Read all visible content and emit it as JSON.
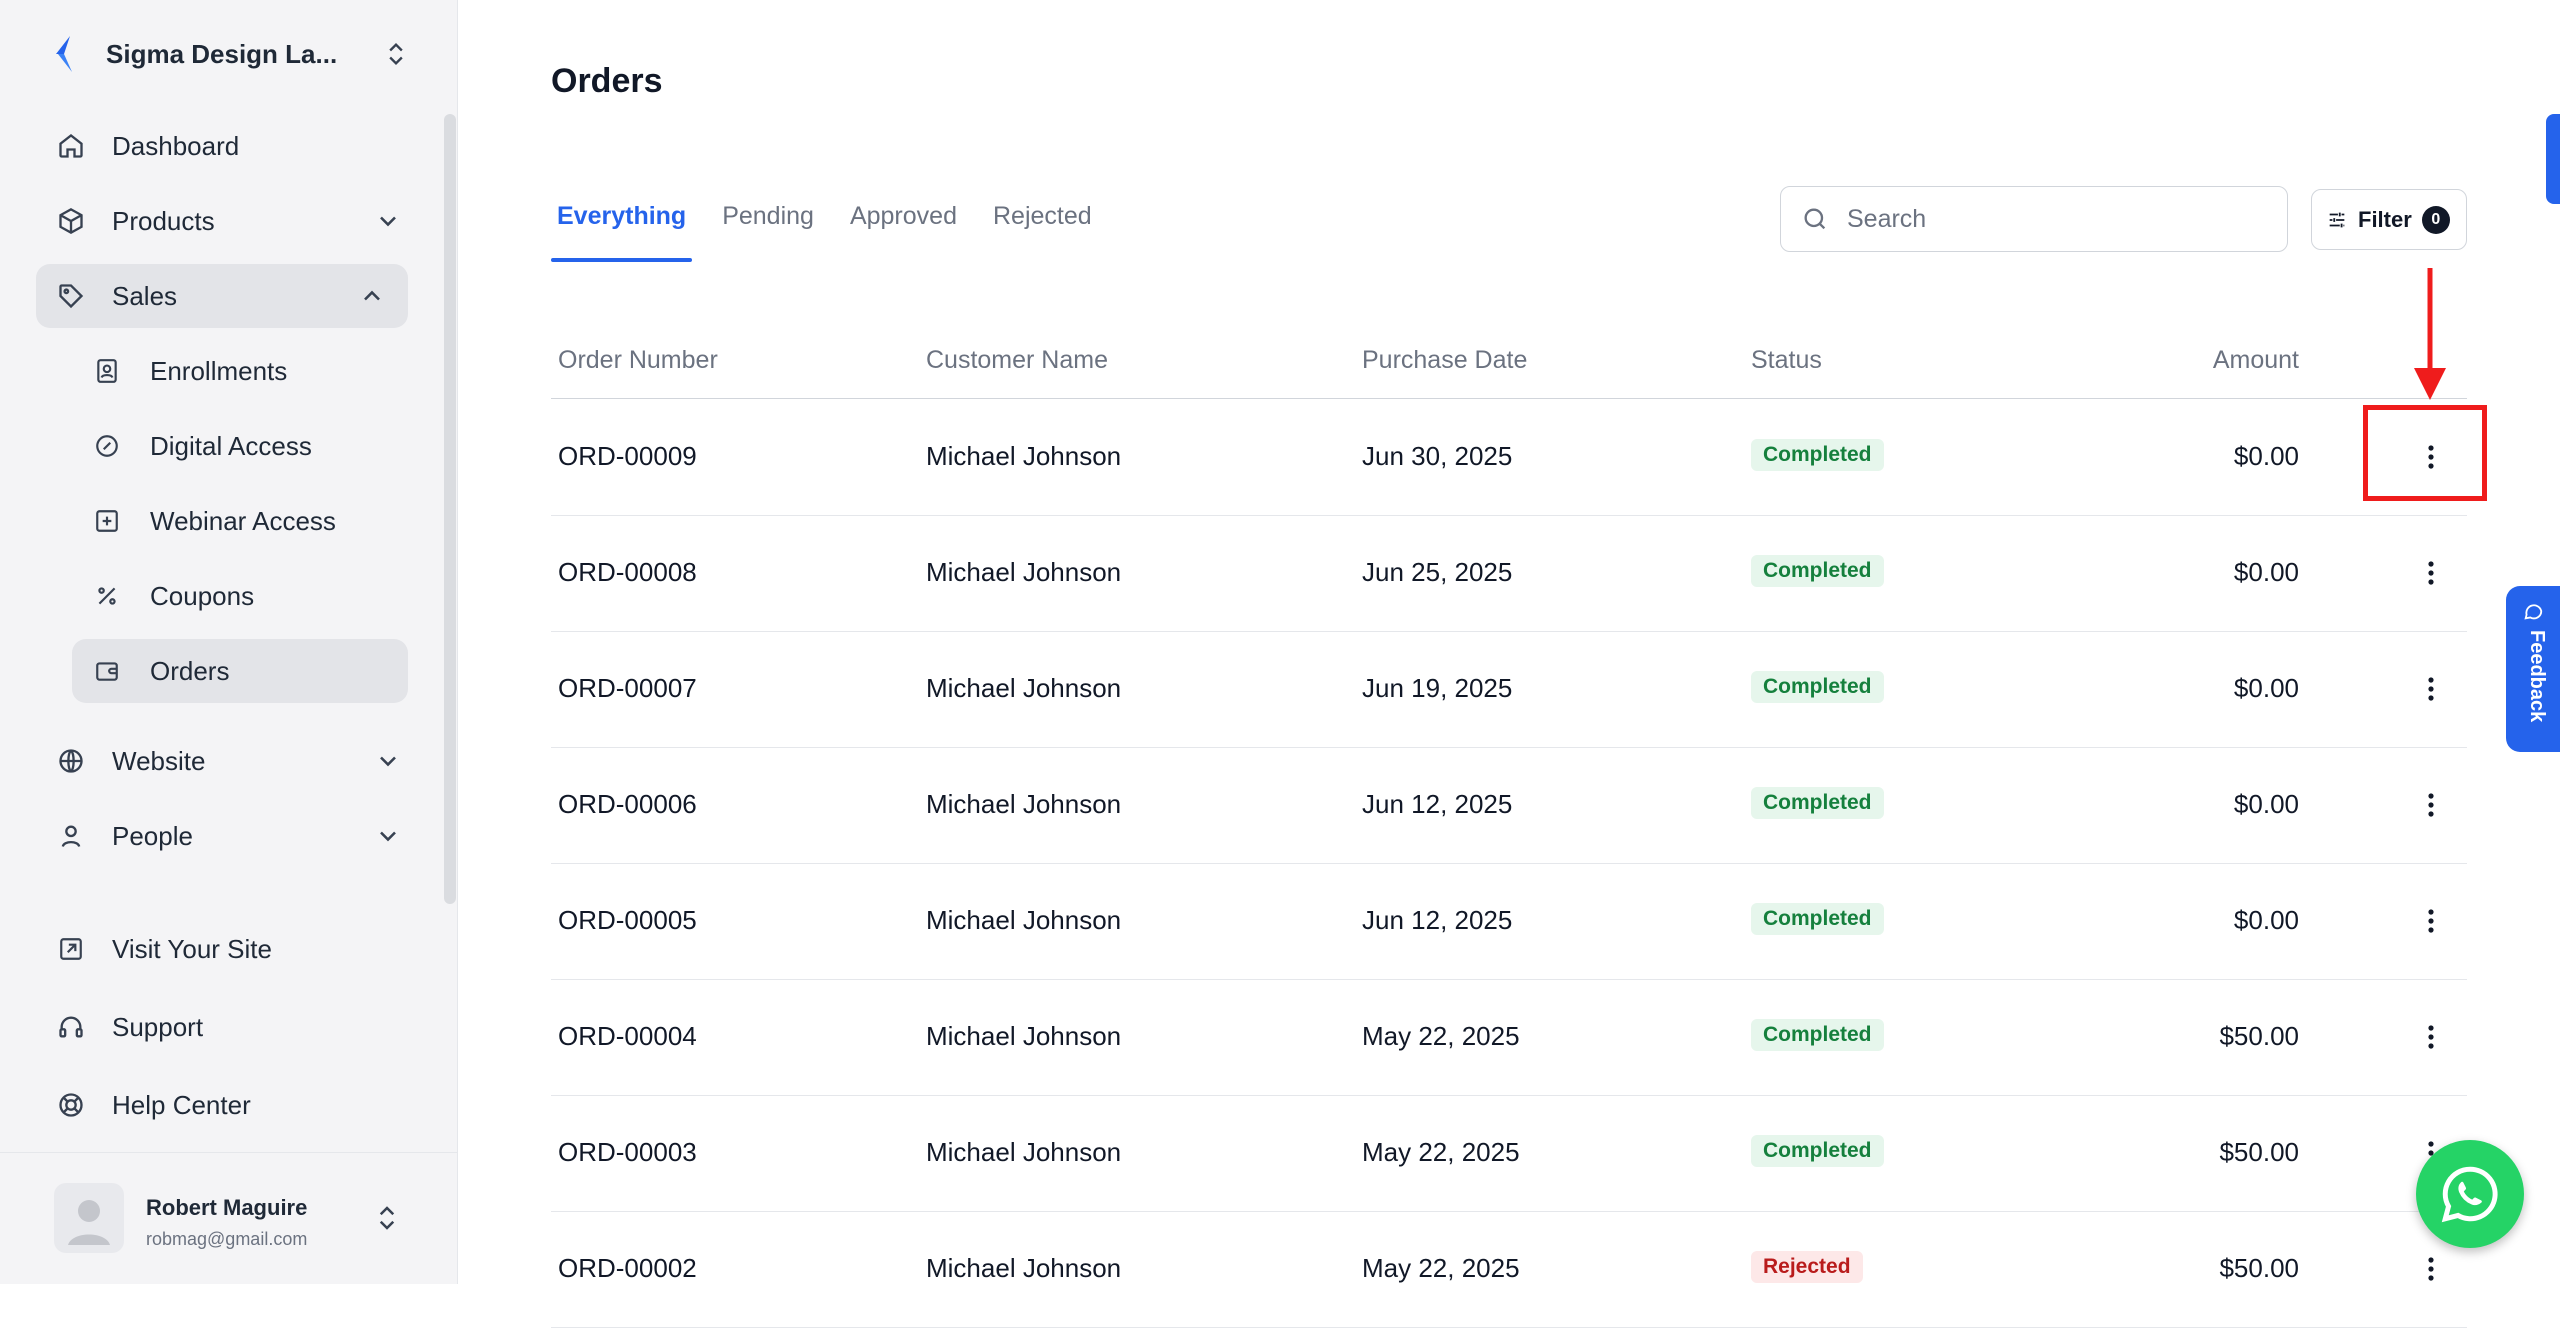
{
  "sidebar": {
    "brand": {
      "name": "Sigma Design La...",
      "logo_color": "#2563eb"
    },
    "nav": {
      "dashboard": "Dashboard",
      "products": "Products",
      "sales": "Sales",
      "enrollments": "Enrollments",
      "digital_access": "Digital Access",
      "webinar_access": "Webinar Access",
      "coupons": "Coupons",
      "orders": "Orders",
      "website": "Website",
      "people": "People"
    },
    "bottom": {
      "visit_site": "Visit Your Site",
      "support": "Support",
      "help_center": "Help Center"
    },
    "user": {
      "name": "Robert Maguire",
      "email": "robmag@gmail.com"
    }
  },
  "main": {
    "title": "Orders",
    "tabs": [
      "Everything",
      "Pending",
      "Approved",
      "Rejected"
    ],
    "active_tab": "Everything",
    "search": {
      "placeholder": "Search"
    },
    "filter": {
      "label": "Filter",
      "count": "0"
    },
    "table": {
      "columns": [
        "Order Number",
        "Customer Name",
        "Purchase Date",
        "Status",
        "Amount"
      ],
      "rows": [
        {
          "order": "ORD-00009",
          "customer": "Michael Johnson",
          "date": "Jun 30, 2025",
          "status": "Completed",
          "amount": "$0.00"
        },
        {
          "order": "ORD-00008",
          "customer": "Michael Johnson",
          "date": "Jun 25, 2025",
          "status": "Completed",
          "amount": "$0.00"
        },
        {
          "order": "ORD-00007",
          "customer": "Michael Johnson",
          "date": "Jun 19, 2025",
          "status": "Completed",
          "amount": "$0.00"
        },
        {
          "order": "ORD-00006",
          "customer": "Michael Johnson",
          "date": "Jun 12, 2025",
          "status": "Completed",
          "amount": "$0.00"
        },
        {
          "order": "ORD-00005",
          "customer": "Michael Johnson",
          "date": "Jun 12, 2025",
          "status": "Completed",
          "amount": "$0.00"
        },
        {
          "order": "ORD-00004",
          "customer": "Michael Johnson",
          "date": "May 22, 2025",
          "status": "Completed",
          "amount": "$50.00"
        },
        {
          "order": "ORD-00003",
          "customer": "Michael Johnson",
          "date": "May 22, 2025",
          "status": "Completed",
          "amount": "$50.00"
        },
        {
          "order": "ORD-00002",
          "customer": "Michael Johnson",
          "date": "May 22, 2025",
          "status": "Rejected",
          "amount": "$50.00"
        }
      ]
    }
  },
  "widgets": {
    "feedback_label": "Feedback"
  },
  "colors": {
    "accent": "#2563eb",
    "completed_bg": "#e6f6ec",
    "completed_text": "#15803d",
    "rejected_bg": "#fde8e8",
    "rejected_text": "#b91c1c",
    "annotation_red": "#ef1c1c",
    "whatsapp_green": "#25d366"
  }
}
